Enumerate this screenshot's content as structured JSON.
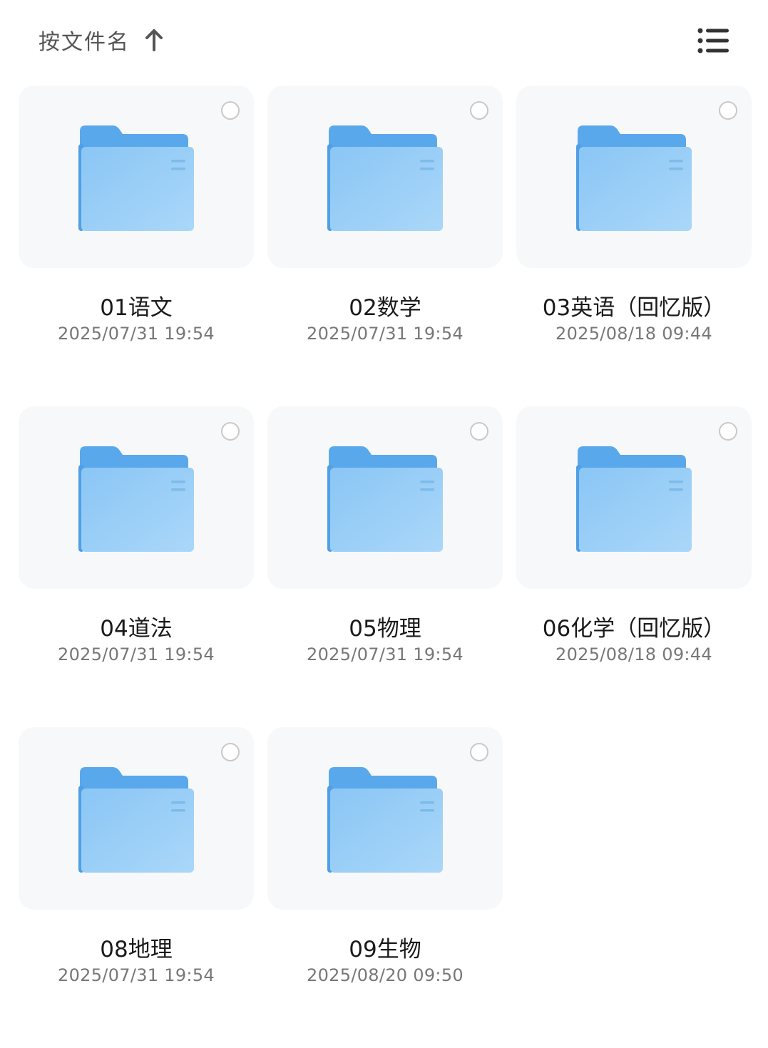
{
  "header": {
    "sort_label": "按文件名",
    "sort_direction_icon": "arrow-up-icon",
    "view_toggle_icon": "list-view-icon"
  },
  "colors": {
    "folder_back": "#5aa8ec",
    "folder_front_top": "#8ac6f5",
    "folder_front_bottom": "#aad7f9",
    "card_bg": "#f7f8f9"
  },
  "folders": [
    {
      "name": "01语文",
      "date": "2025/07/31 19:54"
    },
    {
      "name": "02数学",
      "date": "2025/07/31 19:54"
    },
    {
      "name": "03英语（回忆版）",
      "date": "2025/08/18 09:44"
    },
    {
      "name": "04道法",
      "date": "2025/07/31 19:54"
    },
    {
      "name": "05物理",
      "date": "2025/07/31 19:54"
    },
    {
      "name": "06化学（回忆版）",
      "date": "2025/08/18 09:44"
    },
    {
      "name": "08地理",
      "date": "2025/07/31 19:54"
    },
    {
      "name": "09生物",
      "date": "2025/08/20 09:50"
    }
  ]
}
